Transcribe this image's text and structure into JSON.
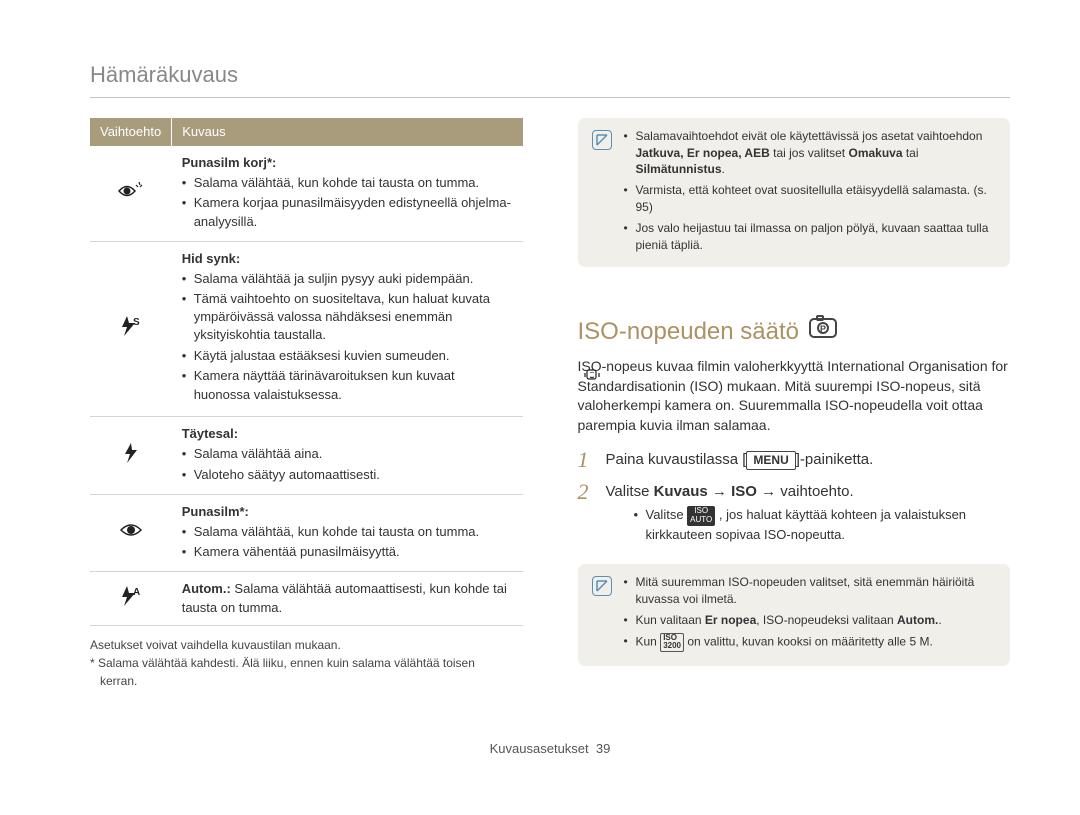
{
  "header": "Hämäräkuvaus",
  "table": {
    "header_option": "Vaihtoehto",
    "header_desc": "Kuvaus",
    "rows": [
      {
        "icon": "eye-sparkle",
        "title": "Punasilm korj*:",
        "bullets": [
          "Salama välähtää, kun kohde tai tausta on tumma.",
          "Kamera korjaa punasilmäisyyden edistyneellä ohjelma-analyysillä."
        ]
      },
      {
        "icon": "flash-s",
        "title": "Hid synk:",
        "bullets": [
          "Salama välähtää ja suljin pysyy auki pidempään.",
          "Tämä vaihtoehto on suositeltava, kun haluat kuvata ympäröivässä valossa nähdäksesi enemmän yksityiskohtia taustalla.",
          "Käytä jalustaa estääksesi kuvien sumeuden.",
          "Kamera näyttää tärinävaroituksen  kun kuvaat huonossa valaistuksessa."
        ],
        "inline_icon_after_word": "tärinävaroituksen",
        "inline_icon": "hand-shake"
      },
      {
        "icon": "flash-fill",
        "title": "Täytesal:",
        "bullets": [
          "Salama välähtää aina.",
          "Valoteho säätyy automaattisesti."
        ]
      },
      {
        "icon": "eye",
        "title": "Punasilm*:",
        "bullets": [
          "Salama välähtää, kun kohde tai tausta on tumma.",
          "Kamera vähentää punasilmäisyyttä."
        ]
      },
      {
        "icon": "flash-a",
        "title_inline": "Autom.:",
        "desc_inline": " Salama välähtää automaattisesti, kun kohde tai tausta on tumma."
      }
    ]
  },
  "footnotes": {
    "line1": "Asetukset voivat vaihdella kuvaustilan mukaan.",
    "line2a": "* Salama välähtää kahdesti. Älä liiku, ennen kuin salama välähtää toisen",
    "line2b": "kerran."
  },
  "note_top": {
    "items": [
      {
        "pre": "Salamavaihtoehdot eivät ole käytettävissä jos asetat vaihtoehdon ",
        "bold": "Jatkuva, Er nopea, AEB",
        "mid": " tai jos valitset ",
        "bold2": "Omakuva",
        "mid2": " tai ",
        "bold3": "Silmätunnistus",
        "post": "."
      },
      {
        "text": "Varmista, että kohteet ovat suositellulla etäisyydellä salamasta. (s. 95)"
      },
      {
        "text": "Jos valo heijastuu tai ilmassa on paljon pölyä, kuvaan saattaa tulla pieniä täpliä."
      }
    ]
  },
  "section": {
    "title": "ISO-nopeuden säätö",
    "mode_icon": "P",
    "body": "ISO-nopeus kuvaa filmin valoherkkyyttä International Organisation for Standardisationin (ISO) mukaan. Mitä suurempi ISO-nopeus, sitä valoherkempi kamera on. Suuremmalla ISO-nopeudella voit ottaa parempia kuvia ilman salamaa.",
    "step1": {
      "pre": "Paina kuvaustilassa [",
      "btn": "MENU",
      "post": "]-painiketta."
    },
    "step2": {
      "pre": "Valitse ",
      "bold": "Kuvaus → ISO →",
      "post": " vaihtoehto."
    },
    "substep": {
      "pre": "Valitse ",
      "icon": "iso-auto",
      "post": ", jos haluat käyttää kohteen ja valaistuksen kirkkauteen sopivaa ISO-nopeutta."
    }
  },
  "note_bottom": {
    "items": [
      {
        "text": "Mitä suuremman ISO-nopeuden valitset, sitä enemmän häiriöitä kuvassa voi ilmetä."
      },
      {
        "pre": "Kun valitaan ",
        "bold": "Er nopea",
        "post": ", ISO-nopeudeksi valitaan ",
        "bold2": "Autom.",
        "post2": "."
      },
      {
        "pre": "Kun ",
        "icon": "iso-3200",
        "post": " on valittu, kuvan kooksi on määritetty alle 5 M."
      }
    ]
  },
  "footer": {
    "label": "Kuvausasetukset",
    "page": "39"
  }
}
